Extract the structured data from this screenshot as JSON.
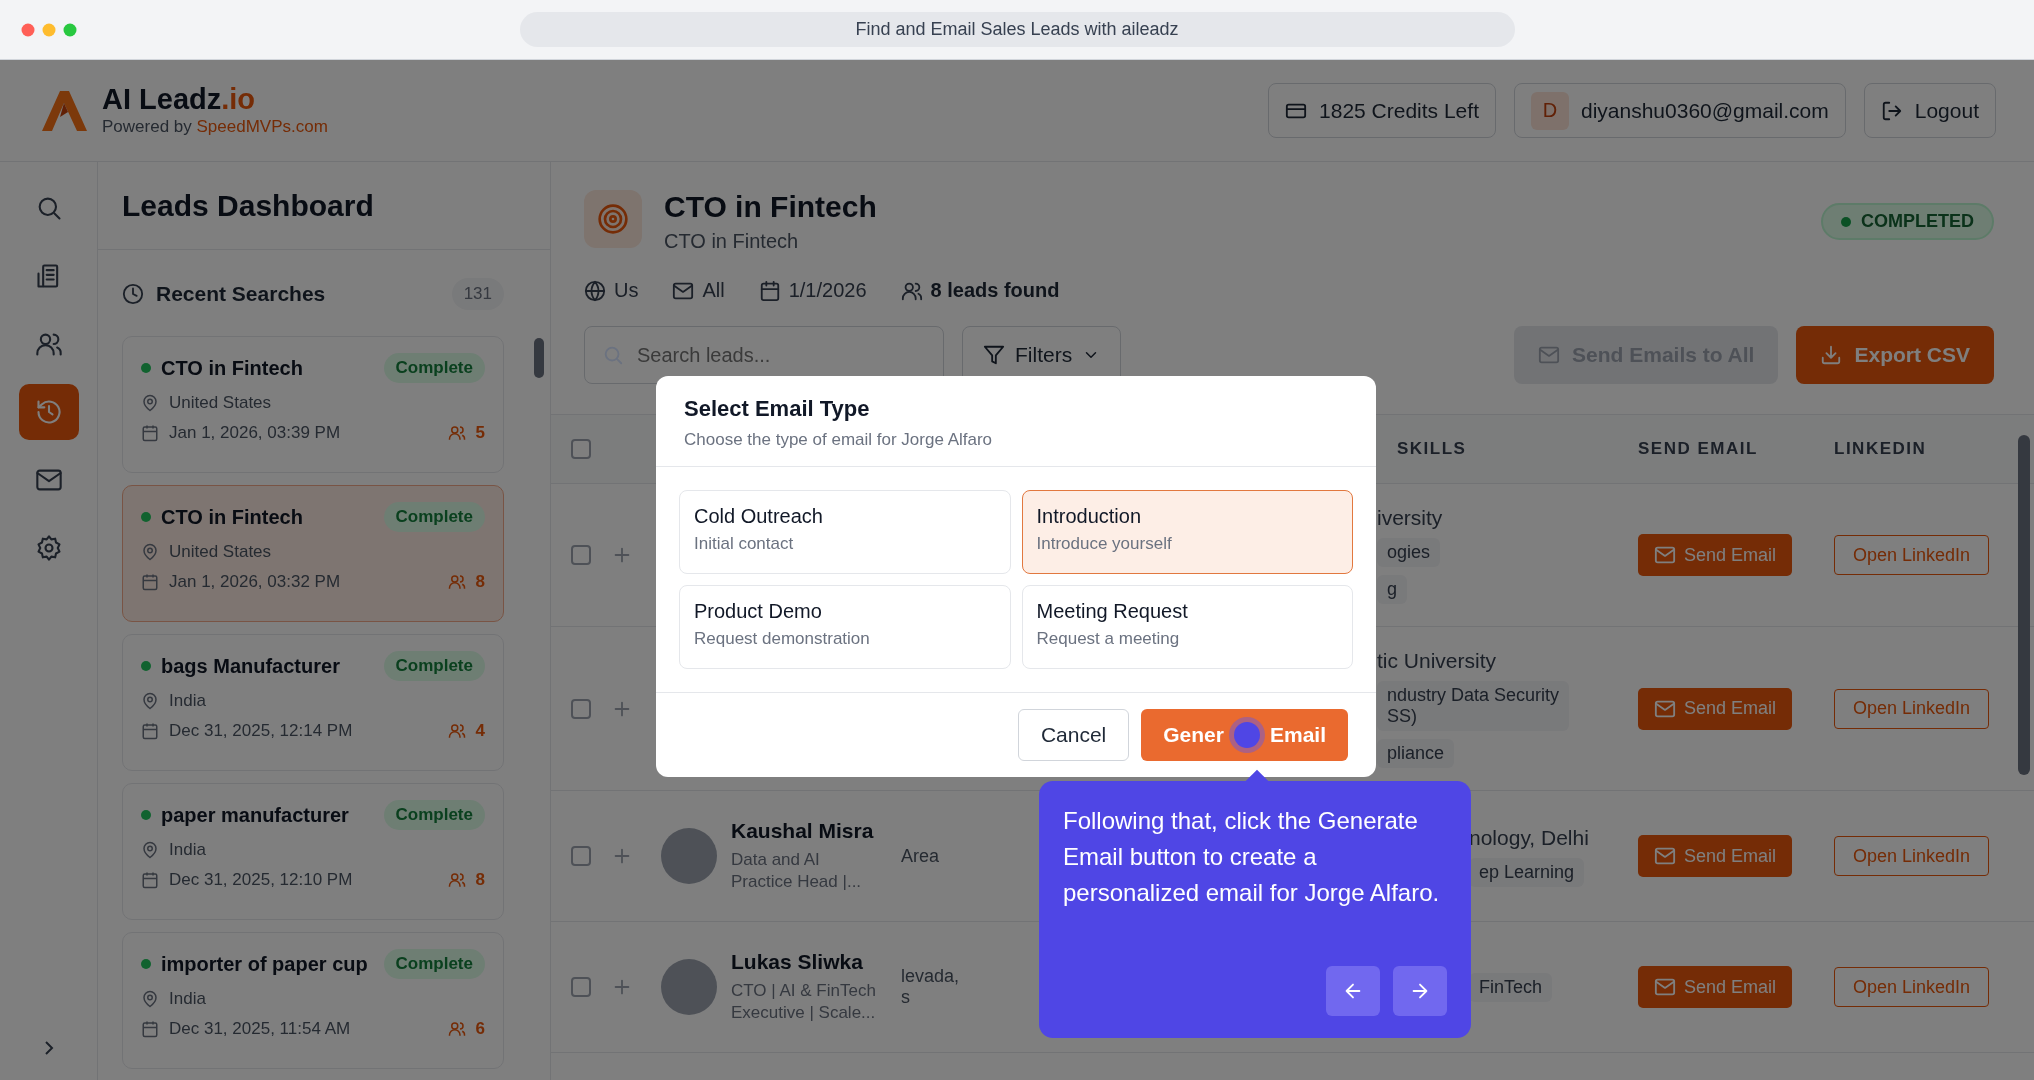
{
  "browser": {
    "title": "Find and Email Sales Leads with aileadz"
  },
  "header": {
    "brand": "AI Leadz",
    "brand_suffix": ".io",
    "powered_prefix": "Powered by",
    "powered_link": "SpeedMVPs.com",
    "credits": "1825 Credits Left",
    "avatar_initial": "D",
    "email": "diyanshu0360@gmail.com",
    "logout": "Logout"
  },
  "rail": {
    "items": [
      {
        "kind": "search",
        "selected": false
      },
      {
        "kind": "building",
        "selected": false
      },
      {
        "kind": "users",
        "selected": false
      },
      {
        "kind": "history",
        "selected": true
      },
      {
        "kind": "mail",
        "selected": false
      },
      {
        "kind": "settings",
        "selected": false
      }
    ]
  },
  "panel": {
    "title": "Leads Dashboard",
    "recent_label": "Recent Searches",
    "recent_count": "131",
    "searches": [
      {
        "title": "CTO in Fintech",
        "status": "Complete",
        "location": "United States",
        "date": "Jan 1, 2026, 03:39 PM",
        "count": "5",
        "selected": false
      },
      {
        "title": "CTO in Fintech",
        "status": "Complete",
        "location": "United States",
        "date": "Jan 1, 2026, 03:32 PM",
        "count": "8",
        "selected": true
      },
      {
        "title": "bags Manufacturer",
        "status": "Complete",
        "location": "India",
        "date": "Dec 31, 2025, 12:14 PM",
        "count": "4",
        "selected": false
      },
      {
        "title": "paper manufacturer",
        "status": "Complete",
        "location": "India",
        "date": "Dec 31, 2025, 12:10 PM",
        "count": "8",
        "selected": false
      },
      {
        "title": "importer of paper cup",
        "status": "Complete",
        "location": "India",
        "date": "Dec 31, 2025, 11:54 AM",
        "count": "6",
        "selected": false
      }
    ]
  },
  "search": {
    "title": "CTO in Fintech",
    "subtitle": "CTO in Fintech",
    "status": "COMPLETED",
    "meta": [
      {
        "kind": "globe",
        "text": "Us",
        "bold": false
      },
      {
        "kind": "mail",
        "text": "All",
        "bold": false
      },
      {
        "kind": "calendar",
        "text": "1/1/2026",
        "bold": false
      },
      {
        "kind": "users",
        "text": "8 leads found",
        "bold": true
      }
    ],
    "search_placeholder": "Search leads...",
    "filters": "Filters",
    "send_all": {
      "label": "Send Emails to All",
      "disabled": true
    },
    "export": "Export CSV"
  },
  "table": {
    "header_checked": false,
    "columns": [
      "SKILLS",
      "SEND EMAIL",
      "LINKEDIN"
    ],
    "rows": [
      {
        "checked": false,
        "skills_text": "iversity",
        "tags": [
          "ogies",
          "g"
        ],
        "send": "Send Email",
        "linkedin": "Open LinkedIn"
      },
      {
        "checked": false,
        "skills_text": "tic University",
        "tags": [
          "ndustry Data Security\nSS)",
          "pliance"
        ],
        "send": "Send Email",
        "linkedin": "Open LinkedIn"
      },
      {
        "checked": false,
        "name": "Kaushal Misra",
        "headline": "Data and AI\nPractice Head |...",
        "location": "Area",
        "skills_text": "nology, Delhi",
        "tags": [
          "ep Learning"
        ],
        "send": "Send Email",
        "linkedin": "Open LinkedIn"
      },
      {
        "checked": false,
        "name": "Lukas Sliwka",
        "headline": "CTO | AI & FinTech\nExecutive | Scale...",
        "location": "levada,\ns",
        "tags": [
          "FinTech"
        ],
        "send": "Send Email",
        "linkedin": "Open LinkedIn"
      }
    ]
  },
  "modal": {
    "title": "Select Email Type",
    "subtitle": "Choose the type of email for Jorge Alfaro",
    "options": [
      {
        "title": "Cold Outreach",
        "desc": "Initial contact",
        "selected": false
      },
      {
        "title": "Introduction",
        "desc": "Introduce yourself",
        "selected": true
      },
      {
        "title": "Product Demo",
        "desc": "Request demonstration",
        "selected": false
      },
      {
        "title": "Meeting Request",
        "desc": "Request a meeting",
        "selected": false
      }
    ],
    "cancel": "Cancel",
    "generate_start": "Gener",
    "generate_end": "Email"
  },
  "tour": {
    "text": "Following that, click the Generate Email button to create a personalized email for Jorge Alfaro."
  }
}
